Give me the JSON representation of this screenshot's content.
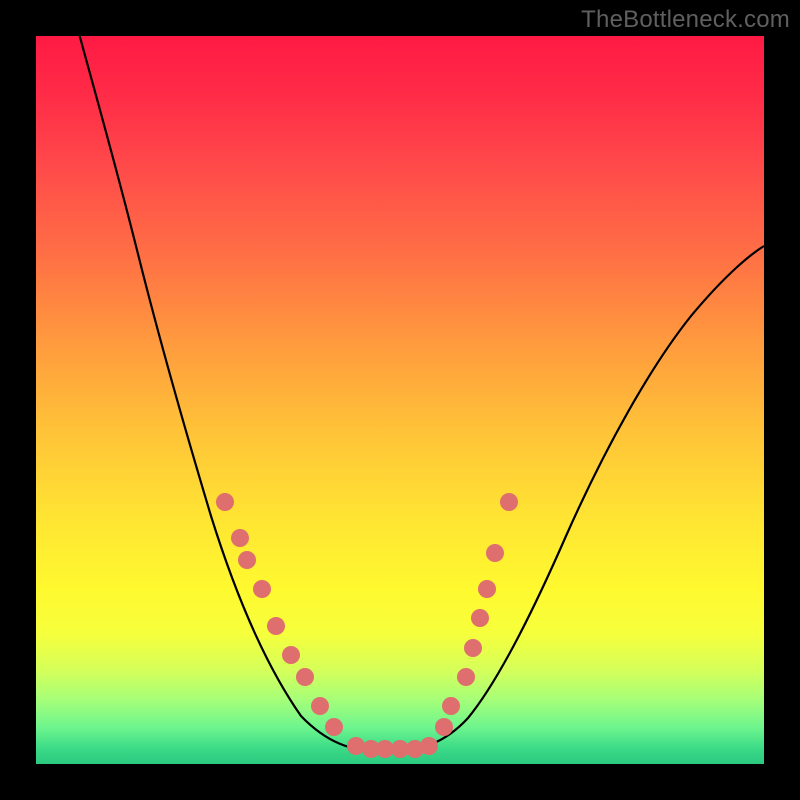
{
  "watermark": "TheBottleneck.com",
  "chart_data": {
    "type": "line",
    "title": "",
    "xlabel": "",
    "ylabel": "",
    "xlim": [
      0,
      100
    ],
    "ylim": [
      0,
      100
    ],
    "background": "rainbow-vertical-red-to-green",
    "series": [
      {
        "name": "bottleneck-curve",
        "x": [
          6,
          10,
          14,
          18,
          22,
          26,
          28,
          30,
          32,
          34,
          36,
          38,
          40,
          42,
          44,
          46,
          48,
          50,
          52,
          54,
          56,
          58,
          60,
          64,
          68,
          72,
          76,
          80,
          84,
          88,
          92,
          96,
          100
        ],
        "y": [
          100,
          90,
          80,
          70,
          60,
          48,
          42,
          36,
          30,
          25,
          20,
          16,
          12,
          8,
          5,
          3,
          2,
          2,
          2,
          3,
          5,
          8,
          12,
          20,
          28,
          35,
          42,
          48,
          54,
          59,
          63,
          66,
          68
        ]
      }
    ],
    "markers": [
      {
        "x": 26,
        "y": 36
      },
      {
        "x": 28,
        "y": 31
      },
      {
        "x": 29,
        "y": 28
      },
      {
        "x": 31,
        "y": 24
      },
      {
        "x": 33,
        "y": 19
      },
      {
        "x": 35,
        "y": 15
      },
      {
        "x": 37,
        "y": 12
      },
      {
        "x": 39,
        "y": 8
      },
      {
        "x": 41,
        "y": 5
      },
      {
        "x": 44,
        "y": 2.5
      },
      {
        "x": 46,
        "y": 2
      },
      {
        "x": 48,
        "y": 2
      },
      {
        "x": 50,
        "y": 2
      },
      {
        "x": 52,
        "y": 2
      },
      {
        "x": 54,
        "y": 2.5
      },
      {
        "x": 56,
        "y": 5
      },
      {
        "x": 57,
        "y": 8
      },
      {
        "x": 59,
        "y": 12
      },
      {
        "x": 60,
        "y": 16
      },
      {
        "x": 61,
        "y": 20
      },
      {
        "x": 62,
        "y": 24
      },
      {
        "x": 63,
        "y": 29
      },
      {
        "x": 65,
        "y": 36
      }
    ],
    "marker_style": {
      "shape": "circle",
      "fill": "#e06a6a",
      "radius_px": 9
    }
  }
}
